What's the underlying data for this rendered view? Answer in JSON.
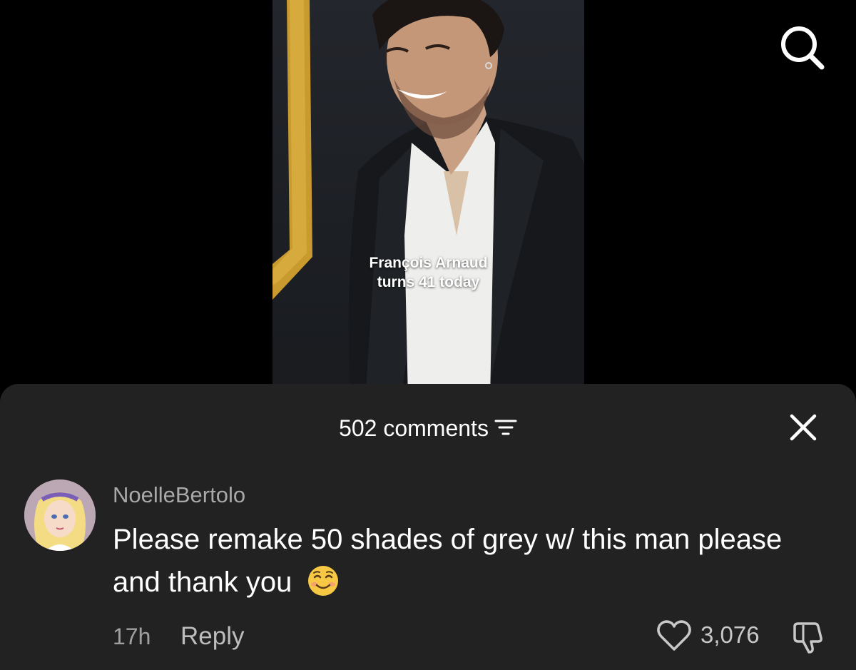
{
  "video": {
    "caption_line1": "François Arnaud",
    "caption_line2": "turns 41 today"
  },
  "icons": {
    "search": "search-icon",
    "sort": "sort-icon",
    "close": "close-icon",
    "like": "heart-icon",
    "dislike": "thumbs-down-icon",
    "emoji": "smiling-face-emoji"
  },
  "comments_sheet": {
    "count_label": "502 comments",
    "comments": [
      {
        "username": "NoelleBertolo",
        "text": "Please remake 50 shades of grey w/ this man please and thank you",
        "emoji": "☺️",
        "timestamp": "17h",
        "reply_label": "Reply",
        "likes": "3,076"
      }
    ]
  },
  "colors": {
    "sheet_bg": "#222222",
    "username": "#a9a9a9",
    "meta": "#a0a0a0",
    "frame_gold": "#c99a2e"
  }
}
